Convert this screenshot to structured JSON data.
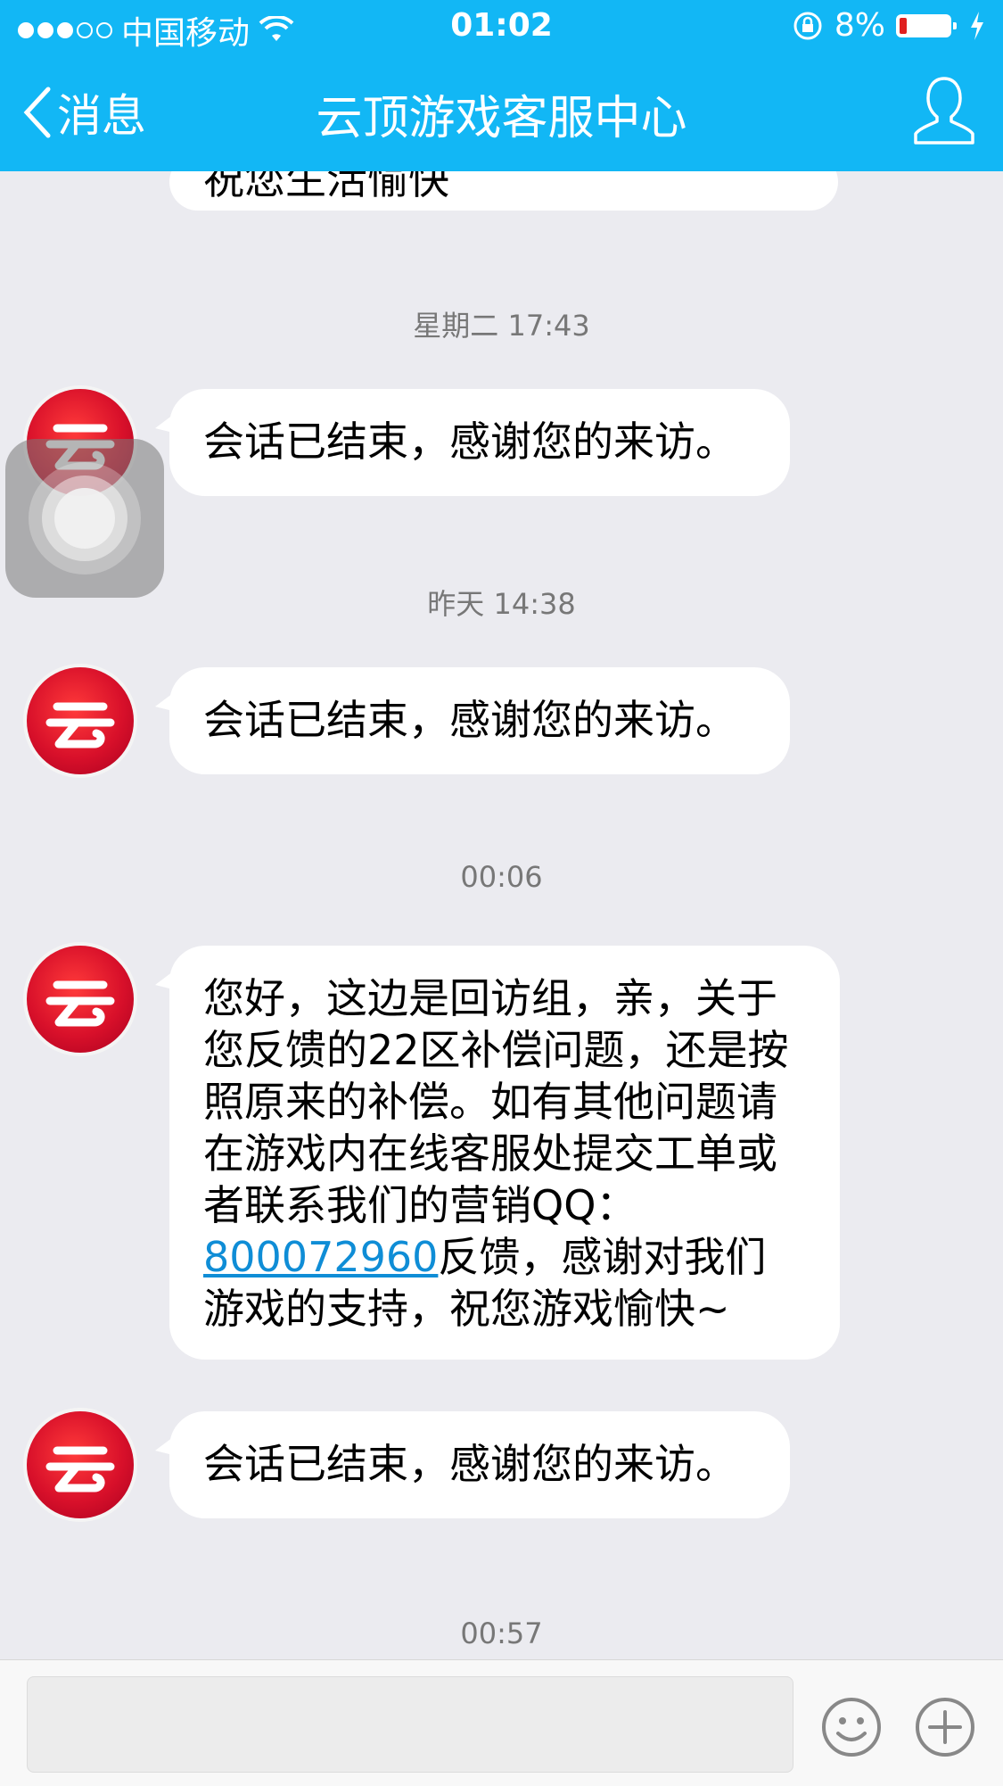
{
  "status_bar": {
    "carrier": "中国移动",
    "time": "01:02",
    "battery_percent": "8%",
    "battery_level": 0.08,
    "signal_dots_filled": 3,
    "signal_dots_total": 5
  },
  "nav": {
    "back_label": "消息",
    "title": "云顶游戏客服中心"
  },
  "chat": {
    "partial_message": "祝您生活愉快",
    "timestamps": [
      "星期二 17:43",
      "昨天 14:38",
      "00:06",
      "00:57"
    ],
    "messages": [
      {
        "text": "会话已结束，感谢您的来访。"
      },
      {
        "text": "会话已结束，感谢您的来访。"
      },
      {
        "text_lines": [
          "您好，这边是回访组，亲，关于",
          "您反馈的22区补偿问题，还是按",
          "照原来的补偿。如有其他问题请",
          "在游戏内在线客服处提交工单或",
          "者联系我们的营销QQ："
        ],
        "link": "800072960",
        "after_link": "反馈，感谢对我们",
        "last_line": "游戏的支持，祝您游戏愉快~"
      },
      {
        "text": "会话已结束，感谢您的来访。"
      }
    ],
    "avatar_glyph": "云"
  },
  "input": {
    "value": "",
    "placeholder": ""
  },
  "colors": {
    "brand": "#12b7f5",
    "link": "#0f8dd6",
    "avatar_red": "#d8102a",
    "chat_background": "#ebebf0"
  },
  "icons": [
    "wifi-icon",
    "rotation-lock-icon",
    "battery-icon",
    "charging-icon",
    "back-chevron-icon",
    "profile-icon",
    "emoji-icon",
    "plus-icon"
  ]
}
